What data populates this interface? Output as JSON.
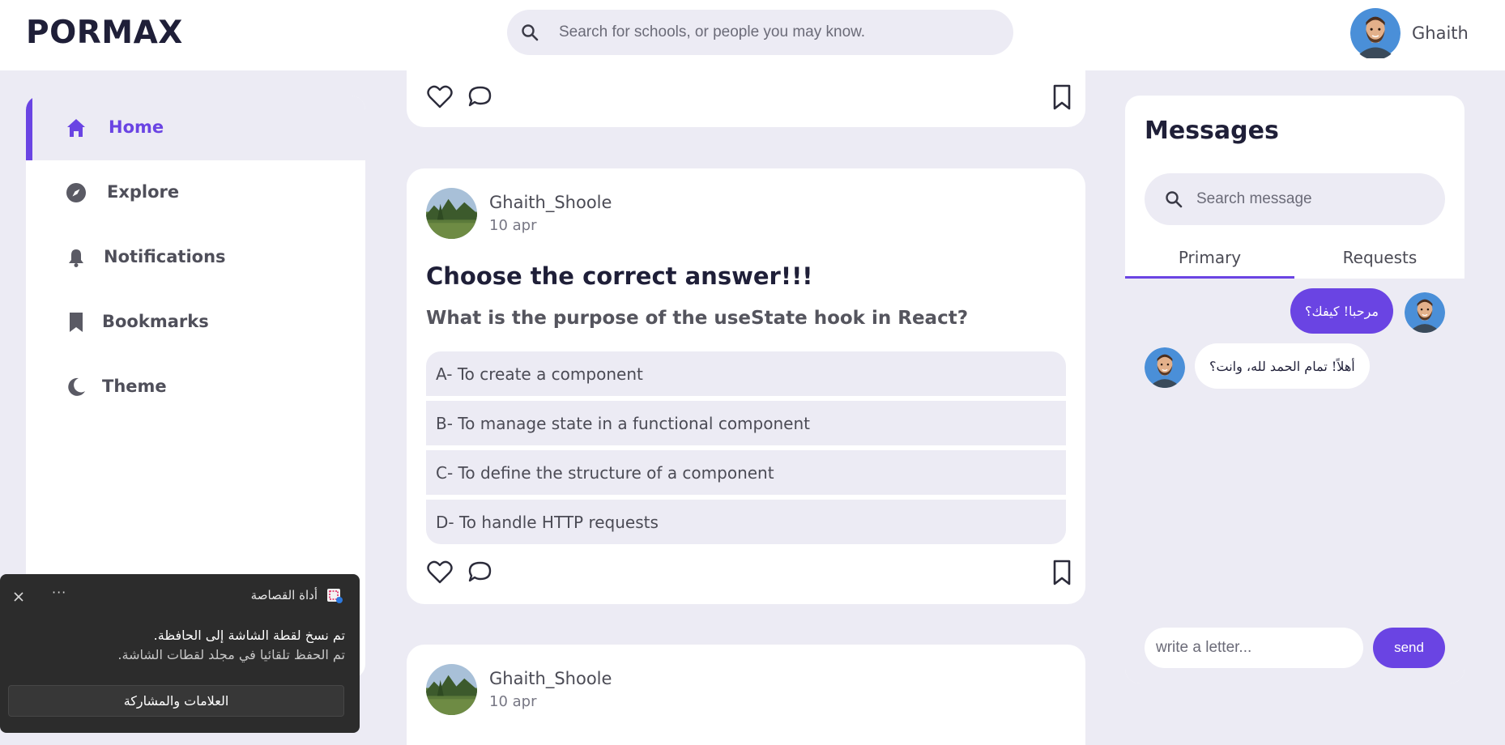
{
  "app": {
    "logo": "PORMAX",
    "search_placeholder": "Search for schools, or people you may know.",
    "user_name": "Ghaith",
    "accent_color": "#6a44e3"
  },
  "sidebar": {
    "items": [
      {
        "label": "Home",
        "icon": "home-icon",
        "active": true
      },
      {
        "label": "Explore",
        "icon": "compass-icon",
        "active": false
      },
      {
        "label": "Notifications",
        "icon": "bell-icon",
        "active": false
      },
      {
        "label": "Bookmarks",
        "icon": "bookmark-icon",
        "active": false
      },
      {
        "label": "Theme",
        "icon": "moon-icon",
        "active": false
      }
    ]
  },
  "feed": {
    "posts": [
      {
        "author": "Ghaith_Shoole",
        "date": "10 apr",
        "title": "Choose the correct answer!!!",
        "question": "What is the purpose of the useState hook in React?",
        "options": [
          "A- To create a component",
          "B- To manage state in a functional component",
          "C- To define the structure of a component",
          "D- To handle HTTP requests"
        ]
      },
      {
        "author": "Ghaith_Shoole",
        "date": "10 apr"
      }
    ]
  },
  "messages": {
    "title": "Messages",
    "search_placeholder": "Search message",
    "tabs": [
      {
        "label": "Primary",
        "active": true
      },
      {
        "label": "Requests",
        "active": false
      }
    ],
    "chat": [
      {
        "text": "مرحبا! كيفك؟",
        "direction": "sent"
      },
      {
        "text": "أهلاً! تمام الحمد لله، وانت؟",
        "direction": "received"
      }
    ],
    "compose_placeholder": "write a letter...",
    "send_label": "send"
  },
  "toast": {
    "app_name": "أداة القصاصة",
    "more": "···",
    "line1": "تم نسخ لقطة الشاشة إلى الحافظة.",
    "line2": "تم الحفظ تلقائيا في مجلد لقطات الشاشة.",
    "button_label": "العلامات والمشاركة"
  }
}
